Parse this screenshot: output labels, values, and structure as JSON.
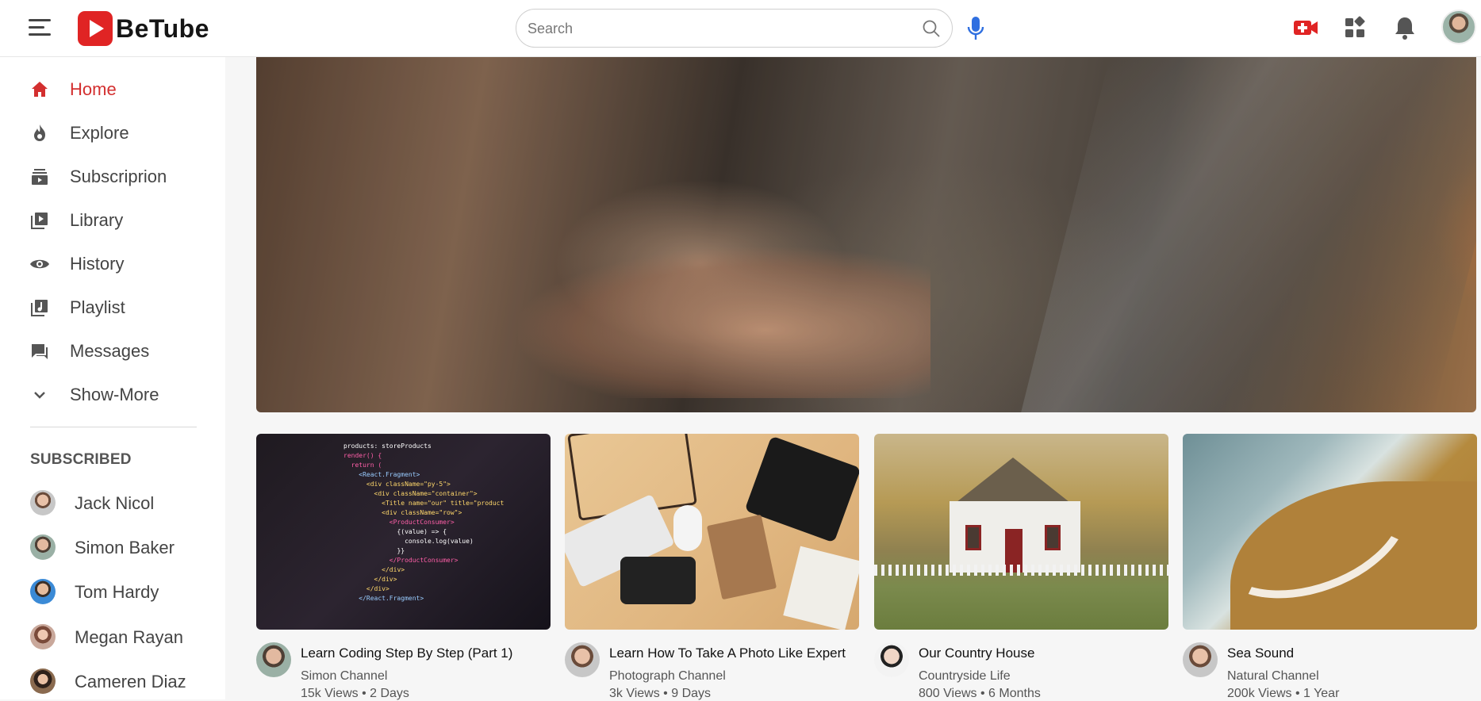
{
  "app": {
    "name": "BeTube"
  },
  "search": {
    "placeholder": "Search"
  },
  "header": {
    "icons": [
      "menu-icon",
      "search-icon",
      "microphone-icon",
      "video-camera-icon",
      "apps-icon",
      "bell-icon",
      "user-avatar"
    ],
    "accent": "#d32f2f"
  },
  "sidebar": {
    "items": [
      {
        "label": "Home",
        "icon": "home-icon",
        "active": true
      },
      {
        "label": "Explore",
        "icon": "flame-icon",
        "active": false
      },
      {
        "label": "Subscriprion",
        "icon": "subscriptions-icon",
        "active": false
      },
      {
        "label": "Library",
        "icon": "library-icon",
        "active": false
      },
      {
        "label": "History",
        "icon": "eye-icon",
        "active": false
      },
      {
        "label": "Playlist",
        "icon": "playlist-icon",
        "active": false
      },
      {
        "label": "Messages",
        "icon": "chat-icon",
        "active": false
      },
      {
        "label": "Show-More",
        "icon": "chevron-down-icon",
        "active": false
      }
    ],
    "subscribed_title": "SUBSCRIBED",
    "subscribed": [
      {
        "name": "Jack Nicol"
      },
      {
        "name": "Simon Baker"
      },
      {
        "name": "Tom Hardy"
      },
      {
        "name": "Megan Rayan"
      },
      {
        "name": "Cameren Diaz"
      }
    ]
  },
  "videos": [
    {
      "title": "Learn Coding Step By Step (Part 1)",
      "channel": "Simon Channel",
      "stats": "15k Views • 2 Days"
    },
    {
      "title": "Learn How To Take A Photo Like Expert",
      "channel": "Photograph Channel",
      "stats": "3k Views • 9 Days"
    },
    {
      "title": "Our Country House",
      "channel": "Countryside Life",
      "stats": "800 Views • 6 Months"
    },
    {
      "title": "Sea Sound",
      "channel": "Natural Channel",
      "stats": "200k Views • 1 Year"
    }
  ]
}
